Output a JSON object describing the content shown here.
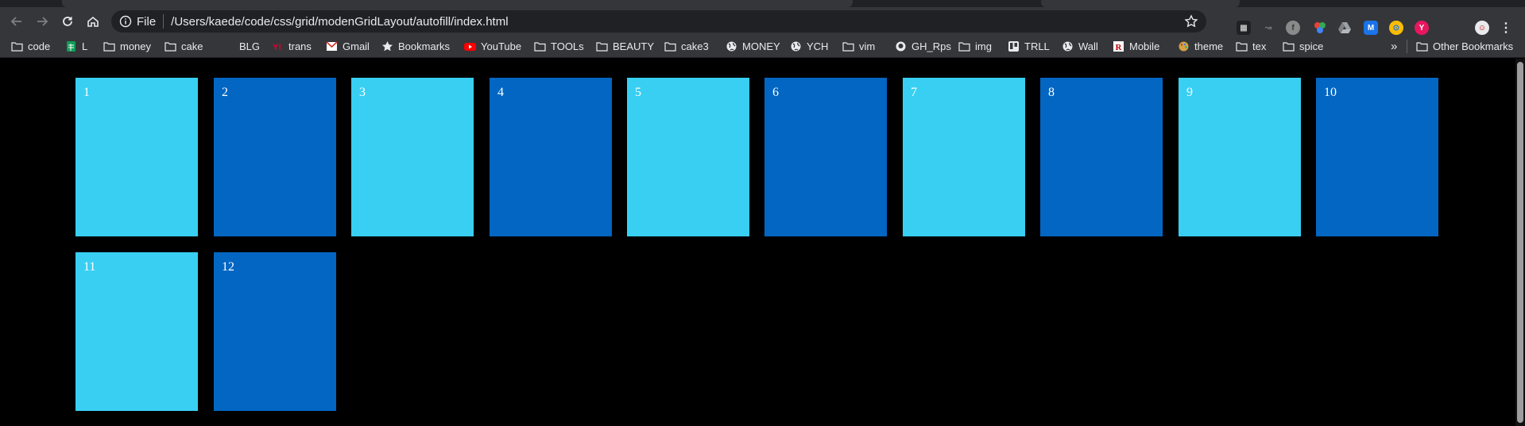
{
  "toolbar": {
    "scheme_label": "File",
    "url": "/Users/kaede/code/css/grid/modenGridLayout/autofill/index.html"
  },
  "bookmarks": [
    {
      "label": "code",
      "icon": "folder-icon"
    },
    {
      "label": "L",
      "icon": "sheets-icon"
    },
    {
      "label": "money",
      "icon": "folder-icon"
    },
    {
      "label": "cake",
      "icon": "folder-icon"
    },
    {
      "label": "BLG",
      "icon": "blank-icon"
    },
    {
      "label": "trans",
      "icon": "yahoo-icon"
    },
    {
      "label": "Gmail",
      "icon": "gmail-icon"
    },
    {
      "label": "Bookmarks",
      "icon": "star-icon"
    },
    {
      "label": "YouTube",
      "icon": "youtube-icon"
    },
    {
      "label": "TOOLs",
      "icon": "folder-icon"
    },
    {
      "label": "BEAUTY",
      "icon": "folder-icon"
    },
    {
      "label": "cake3",
      "icon": "folder-icon"
    },
    {
      "label": "MONEY",
      "icon": "globe-icon"
    },
    {
      "label": "YCH",
      "icon": "globe-icon"
    },
    {
      "label": "vim",
      "icon": "folder-icon"
    },
    {
      "label": "GH_Rps",
      "icon": "github-icon"
    },
    {
      "label": "img",
      "icon": "folder-icon"
    },
    {
      "label": "TRLL",
      "icon": "trello-icon"
    },
    {
      "label": "Wall",
      "icon": "globe-icon"
    },
    {
      "label": "Mobile",
      "icon": "rakuten-icon"
    },
    {
      "label": "theme",
      "icon": "palette-icon"
    },
    {
      "label": "tex",
      "icon": "folder-icon"
    },
    {
      "label": "spice",
      "icon": "folder-icon"
    }
  ],
  "overflow_label": "»",
  "other_bookmarks_label": "Other Bookmarks",
  "grid_items": [
    "1",
    "2",
    "3",
    "4",
    "5",
    "6",
    "7",
    "8",
    "9",
    "10",
    "11",
    "12"
  ],
  "colors": {
    "item_light": "#38cff3",
    "item_dark": "#0266c2",
    "page_background": "#000000",
    "toolbar": "#35363a"
  }
}
